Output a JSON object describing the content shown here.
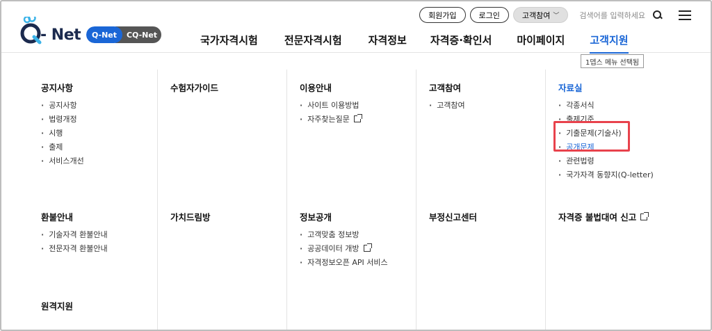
{
  "logo": {
    "net": "- Net",
    "pill_a": "Q-Net",
    "pill_b": "CQ-Net"
  },
  "util": {
    "signup": "회원가입",
    "login": "로그인",
    "participate": "고객참여",
    "search_placeholder": "검색어를 입력하세요"
  },
  "gnb": [
    "국가자격시험",
    "전문자격시험",
    "자격정보",
    "자격증·확인서",
    "마이페이지",
    "고객지원"
  ],
  "tooltip": "1뎁스 메뉴 선택됨",
  "columns": [
    [
      {
        "title": "공지사항",
        "items": [
          "공지사항",
          "법령개정",
          "시행",
          "출제",
          "서비스개선"
        ]
      },
      {
        "title": "환불안내",
        "items": [
          "기술자격 환불안내",
          "전문자격 환불안내"
        ]
      },
      {
        "title": "원격지원",
        "items": []
      }
    ],
    [
      {
        "title": "수험자가이드",
        "items": []
      },
      {
        "title": "가치드림방",
        "items": []
      }
    ],
    [
      {
        "title": "이용안내",
        "items": [
          "사이트 이용방법",
          "자주찾는질문"
        ]
      },
      {
        "title": "정보공개",
        "items": [
          "고객맞춤 정보방",
          "공공데이터 개방",
          "자격정보오픈 API 서비스"
        ]
      }
    ],
    [
      {
        "title": "고객참여",
        "items": [
          "고객참여"
        ]
      },
      {
        "title": "부정신고센터",
        "items": []
      }
    ],
    [
      {
        "title": "자료실",
        "items": [
          "각종서식",
          "출제기준",
          "기출문제(기술사)",
          "공개문제",
          "관련법령",
          "국가자격 동향지(Q-letter)"
        ]
      },
      {
        "title": "자격증 불법대여 신고",
        "items": []
      }
    ]
  ],
  "colors": {
    "accent": "#1a66d6",
    "highlight": "#e8424c"
  }
}
